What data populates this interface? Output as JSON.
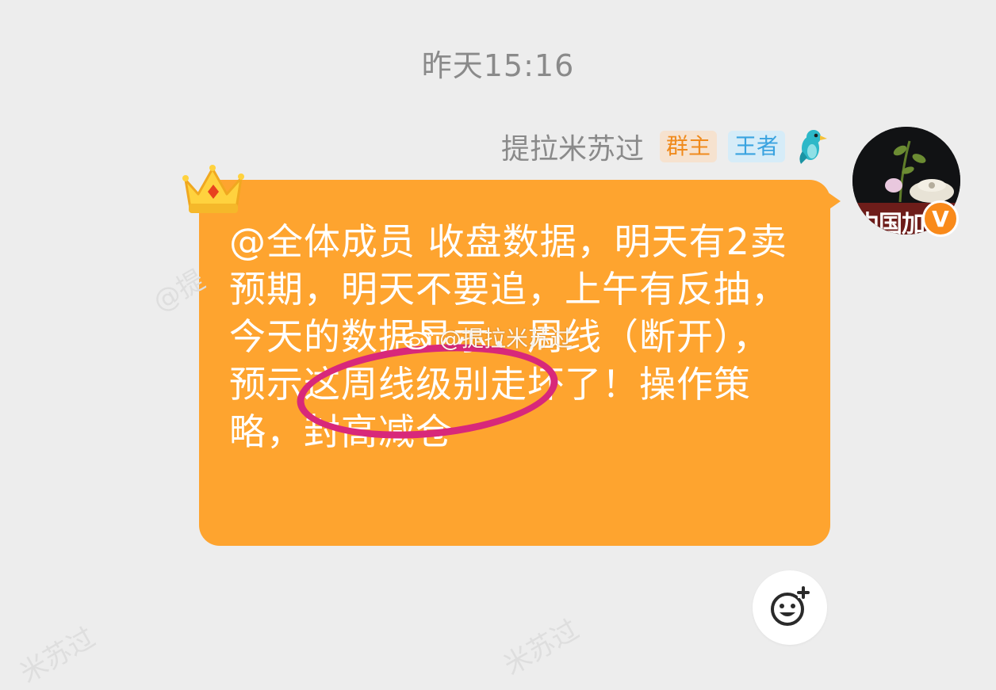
{
  "timestamp": "昨天15:16",
  "sender": {
    "name": "提拉米苏过",
    "badges": [
      "群主",
      "王者"
    ],
    "badge_colors": {
      "owner": "#f08a1c",
      "king": "#3aa3e0"
    },
    "level_icon": "blue-bird-icon"
  },
  "avatar": {
    "text": "中国加",
    "verified_icon": "verified-v-icon",
    "verified_text": "V"
  },
  "message": {
    "text": "@全体成员 收盘数据，明天有2卖预期，明天不要追，上午有反抽，今天的数据显示，周线（断开），预示这周线级别走坏了！操作策略，封高减仓",
    "bubble_color": "#fea42f",
    "decoration_icon": "crown-icon"
  },
  "annotation": {
    "highlight_color": "#d8287a"
  },
  "watermark": {
    "text": "@提拉米苏过",
    "faint": [
      "@提",
      "米苏过",
      "米苏过"
    ]
  },
  "emoji_button": {
    "icon": "smiley-plus-icon"
  }
}
